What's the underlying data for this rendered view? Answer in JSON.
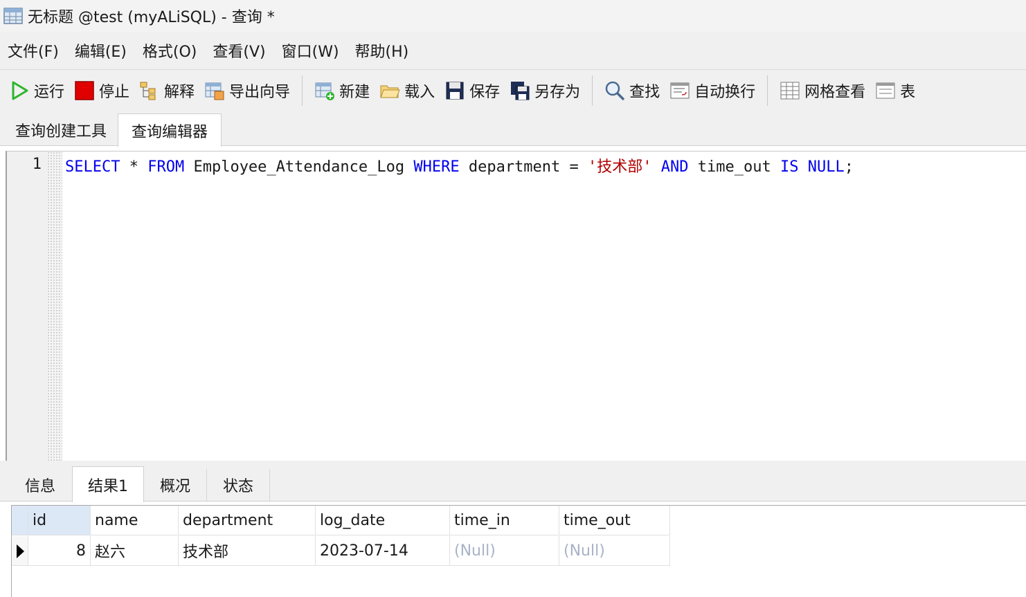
{
  "window": {
    "title": "无标题 @test (myALiSQL) - 查询 *",
    "app_icon": "table-grid-icon"
  },
  "menu": {
    "items": [
      "文件(F)",
      "编辑(E)",
      "格式(O)",
      "查看(V)",
      "窗口(W)",
      "帮助(H)"
    ]
  },
  "toolbar": {
    "run": "运行",
    "stop": "停止",
    "explain": "解释",
    "export_wizard": "导出向导",
    "new": "新建",
    "load": "载入",
    "save": "保存",
    "save_as": "另存为",
    "find": "查找",
    "word_wrap": "自动换行",
    "grid_view": "网格查看",
    "form_view_partial": "表"
  },
  "query_tabs": {
    "builder": "查询创建工具",
    "editor": "查询编辑器",
    "active": "editor"
  },
  "editor": {
    "line_number": "1",
    "sql_tokens": [
      {
        "text": "SELECT",
        "kind": "kw"
      },
      {
        "text": " * ",
        "kind": "plain"
      },
      {
        "text": "FROM",
        "kind": "kw"
      },
      {
        "text": " Employee_Attendance_Log ",
        "kind": "plain"
      },
      {
        "text": "WHERE",
        "kind": "kw"
      },
      {
        "text": " department = ",
        "kind": "plain"
      },
      {
        "text": "'技术部'",
        "kind": "str"
      },
      {
        "text": " ",
        "kind": "plain"
      },
      {
        "text": "AND",
        "kind": "kw"
      },
      {
        "text": " time_out ",
        "kind": "plain"
      },
      {
        "text": "IS",
        "kind": "kw"
      },
      {
        "text": " ",
        "kind": "plain"
      },
      {
        "text": "NULL",
        "kind": "kw"
      },
      {
        "text": ";",
        "kind": "plain"
      }
    ]
  },
  "result_tabs": {
    "info": "信息",
    "result1": "结果1",
    "profile": "概况",
    "status": "状态",
    "active": "result1"
  },
  "grid": {
    "columns": [
      "id",
      "name",
      "department",
      "log_date",
      "time_in",
      "time_out"
    ],
    "rows": [
      {
        "id": "8",
        "name": "赵六",
        "department": "技术部",
        "log_date": "2023-07-14",
        "time_in": "(Null)",
        "time_out": "(Null)"
      }
    ]
  },
  "colors": {
    "keyword": "#0000ee",
    "string": "#b00000",
    "null_text": "#a8b2c8",
    "selected_header": "#dce8f6",
    "stop_red": "#e00000",
    "run_green": "#2db52d"
  }
}
